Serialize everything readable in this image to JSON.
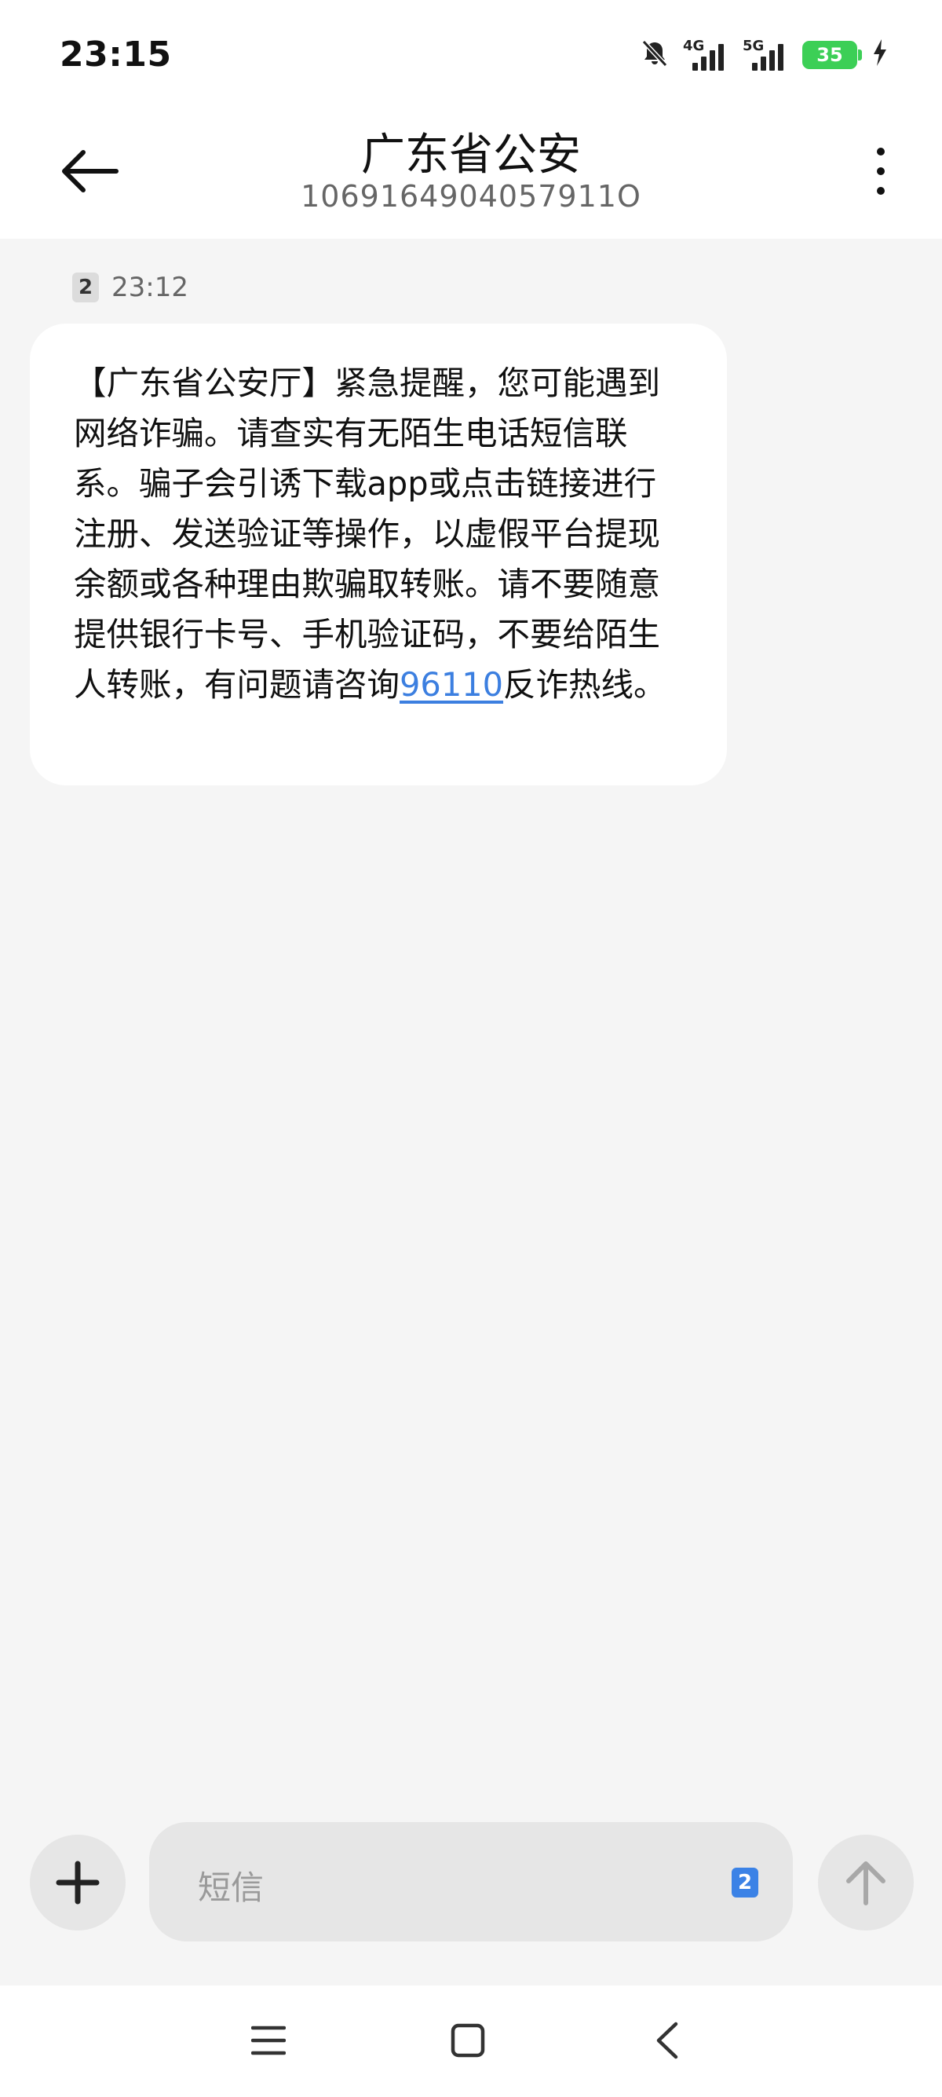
{
  "status_bar": {
    "time": "23:15",
    "network_1": "4G",
    "network_2": "5G",
    "battery_level": "35",
    "icons": [
      "bell-off-icon",
      "signal-icon",
      "battery-icon",
      "charging-icon"
    ]
  },
  "header": {
    "title": "广东省公安",
    "phone_number": "1069164904057911O"
  },
  "message": {
    "sim_slot": "2",
    "time": "23:12",
    "text_before_link": "【广东省公安厅】紧急提醒，您可能遇到网络诈骗。请查实有无陌生电话短信联系。骗子会引诱下载app或点击链接进行注册、发送验证等操作，以虚假平台提现余额或各种理由欺骗取转账。请不要随意提供银行卡号、手机验证码，不要给陌生人转账，有问题请咨询",
    "link_text": "96110",
    "text_after_link": "反诈热线。"
  },
  "composer": {
    "placeholder": "短信",
    "sim_slot": "2"
  },
  "colors": {
    "link": "#3c7fe0",
    "battery": "#3ccf56",
    "sim_badge_active": "#3b82e6"
  }
}
